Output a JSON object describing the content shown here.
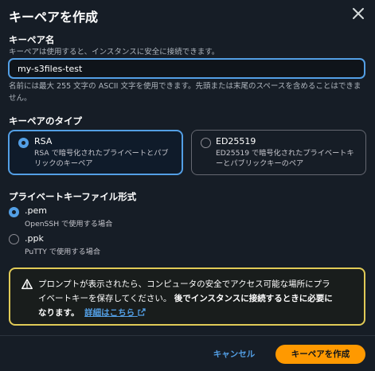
{
  "dialog": {
    "title": "キーペアを作成",
    "close_icon": "close-icon"
  },
  "key_name": {
    "label": "キーペア名",
    "description": "キーペアは使用すると、インスタンスに安全に接続できます。",
    "value": "my-s3files-test",
    "constraint": "名前には最大 255 文字の ASCII 文字を使用できます。先頭または末尾のスペースを含めることはできません。"
  },
  "key_type": {
    "label": "キーペアのタイプ",
    "options": [
      {
        "title": "RSA",
        "desc_line1": "RSA で暗号化されたプライベートとパブ",
        "desc_line2": "リックのキーペア",
        "selected": true
      },
      {
        "title": "ED25519",
        "desc_line1": "ED25519 で暗号化されたプライベートキ",
        "desc_line2": "ーとパブリックキーのペア",
        "selected": false
      }
    ]
  },
  "file_format": {
    "label": "プライベートキーファイル形式",
    "options": [
      {
        "title": ".pem",
        "desc": "OpenSSH で使用する場合",
        "selected": true
      },
      {
        "title": ".ppk",
        "desc": "PuTTY で使用する場合",
        "selected": false
      }
    ]
  },
  "alert": {
    "icon": "warning-icon",
    "text_line1": "プロンプトが表示されたら、コンピュータの安全でアクセス可能な場所にプラ",
    "text_line2": "イベートキーを保存してください。",
    "bold_line2": "後でインスタンスに接続するときに必要に",
    "bold_line3": "なります。",
    "link_label": "詳細はこちら",
    "link_icon": "external-link-icon"
  },
  "footer": {
    "cancel_label": "キャンセル",
    "create_label": "キーペアを作成"
  },
  "colors": {
    "background": "#161d26",
    "accent": "#539fe5",
    "primary_button": "#ff9900",
    "warning": "#e0ca57"
  }
}
